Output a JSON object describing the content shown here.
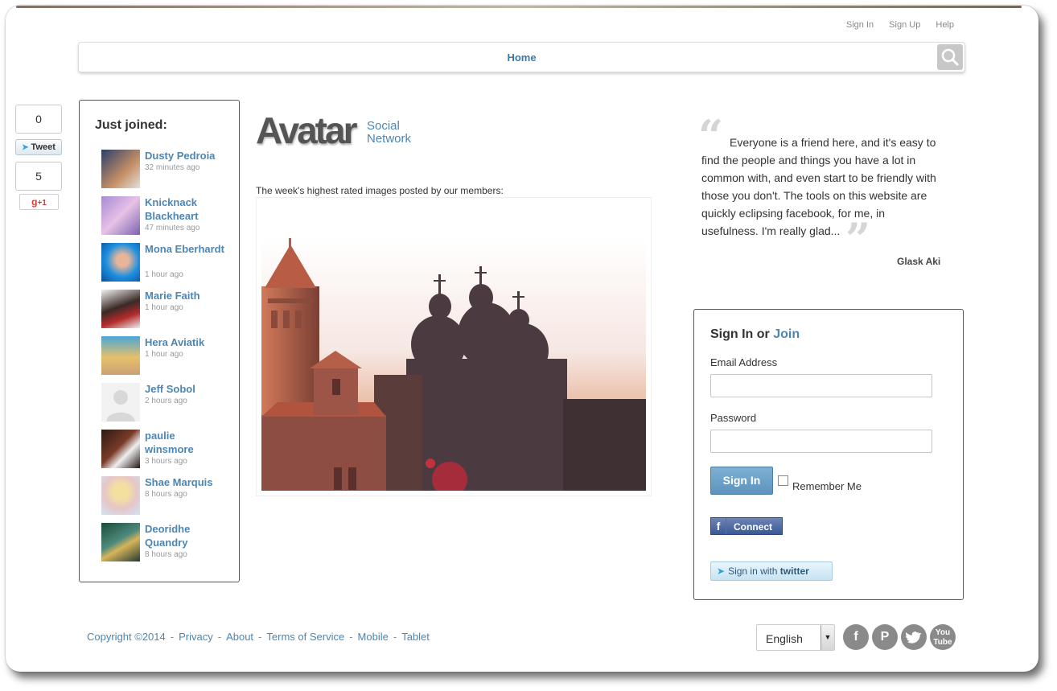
{
  "top_links": [
    "Sign In",
    "Sign Up",
    "Help"
  ],
  "nav": {
    "home": "Home"
  },
  "social": {
    "tweet_count": "0",
    "tweet_label": "Tweet",
    "gplus_count": "5",
    "gplus_label": "+1"
  },
  "just_joined": {
    "title": "Just joined:",
    "members": [
      {
        "name": "Dusty Pedroia",
        "time": "32 minutes ago"
      },
      {
        "name": "Knicknack Blackheart",
        "time": "47 minutes ago"
      },
      {
        "name": "Mona Eberhardt",
        "time": "1 hour ago"
      },
      {
        "name": "Marie Faith",
        "time": "1 hour ago"
      },
      {
        "name": "Hera Aviatik",
        "time": "1 hour ago"
      },
      {
        "name": "Jeff Sobol",
        "time": "2 hours ago"
      },
      {
        "name": "paulie winsmore",
        "time": "3 hours ago"
      },
      {
        "name": "Shae Marquis",
        "time": "8 hours ago"
      },
      {
        "name": "Deoridhe Quandry",
        "time": "8 hours ago"
      }
    ]
  },
  "logo": {
    "main": "Avatar",
    "sub_line1": "Social",
    "sub_line2": "Network"
  },
  "rated_text": "The week's highest rated images posted by our members:",
  "testimonial": {
    "text": "Everyone is a friend here, and it's easy to find the people and things you have a lot in common with, and even start to be friendly with those you don't. The tools on this website are quickly eclipsing facebook, for me, in usefulness. I'm really glad...",
    "author": "Glask Aki"
  },
  "signin": {
    "title": "Sign In or",
    "join": "Join",
    "email_label": "Email Address",
    "email_value": "",
    "password_label": "Password",
    "button": "Sign In",
    "remember": "Remember Me",
    "facebook": "Connect",
    "twitter_prefix": "Sign in with",
    "twitter_brand": "twitter"
  },
  "footer": {
    "copyright": "Copyright ©2014",
    "links": [
      "Privacy",
      "About",
      "Terms of Service",
      "Mobile",
      "Tablet"
    ]
  },
  "language": "English",
  "social_icons": [
    "facebook-icon",
    "pinterest-icon",
    "twitter-icon",
    "youtube-icon"
  ]
}
